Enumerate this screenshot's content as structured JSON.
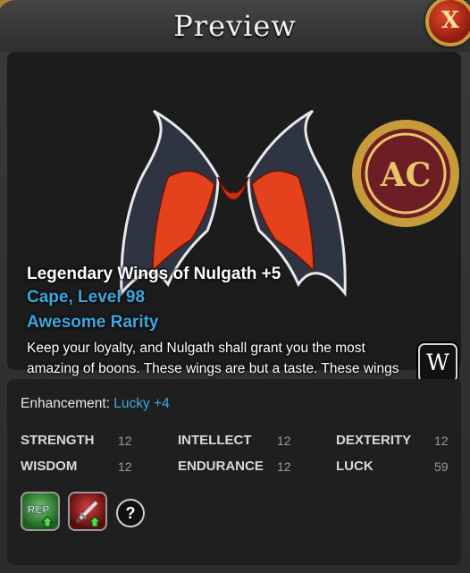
{
  "window": {
    "title": "Preview",
    "close_label": "X"
  },
  "item": {
    "name": "Legendary Wings of Nulgath +5",
    "type_level": "Cape, Level 98",
    "rarity": "Awesome Rarity",
    "description": "Keep your loyalty, and Nulgath shall grant you the most amazing of boons. These wings are but a taste. These wings do more damage against dragons, humans, and give you a bit of extra reputation from"
  },
  "emblem": {
    "label": "AC"
  },
  "side_buttons": {
    "wiki_label": "W"
  },
  "enhancement": {
    "label": "Enhancement:",
    "value": "Lucky +4"
  },
  "stats": [
    {
      "name": "STRENGTH",
      "value": "12"
    },
    {
      "name": "INTELLECT",
      "value": "12"
    },
    {
      "name": "DEXTERITY",
      "value": "12"
    },
    {
      "name": "WISDOM",
      "value": "12"
    },
    {
      "name": "ENDURANCE",
      "value": "12"
    },
    {
      "name": "LUCK",
      "value": "59"
    }
  ],
  "boosts": {
    "rep_label": "REP",
    "help_label": "?"
  },
  "colors": {
    "accent_blue": "#3ca9e0",
    "gold": "#c79a3a",
    "close_red": "#b8281a"
  }
}
